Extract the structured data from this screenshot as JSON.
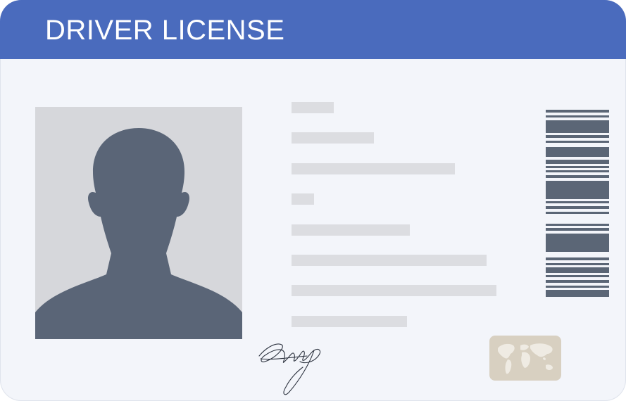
{
  "header": {
    "title": "DRIVER LICENSE"
  },
  "colors": {
    "header_blue": "#4a6bbd",
    "card_background": "#f3f5fa",
    "photo_background": "#d6d7db",
    "silhouette": "#5a6577",
    "field_placeholder": "#dcdde1",
    "barcode": "#5b6676",
    "hologram_chip": "#d8d0c1"
  },
  "icons": {
    "photo": "person-silhouette-icon",
    "signature": "signature-scribble",
    "chip": "world-map-hologram-icon",
    "barcode": "barcode-icon"
  }
}
